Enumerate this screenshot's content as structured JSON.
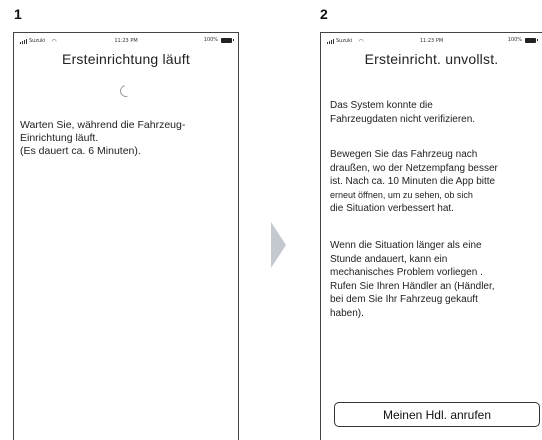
{
  "steps": [
    {
      "number": "1",
      "status_bar": {
        "carrier": "Suzuki",
        "time": "11:23 PM",
        "battery": "100%"
      },
      "title": "Ersteinrichtung läuft",
      "body_lines": [
        "Warten Sie, während die Fahrzeug-",
        "Einrichtung läuft.",
        "(Es dauert ca. 6 Minuten)."
      ]
    },
    {
      "number": "2",
      "status_bar": {
        "carrier": "Suzuki",
        "time": "11:23 PM",
        "battery": "100%"
      },
      "title": "Ersteinricht. unvollst.",
      "paragraph1": [
        "Das System konnte die",
        "Fahrzeugdaten nicht verifizieren."
      ],
      "paragraph2": [
        "Bewegen Sie das Fahrzeug nach",
        "draußen, wo der Netzempfang besser",
        "ist. Nach ca. 10 Minuten die App bitte",
        "erneut öffnen, um zu sehen, ob sich",
        "die Situation verbessert hat."
      ],
      "paragraph3": [
        "Wenn die Situation länger als eine",
        "Stunde andauert, kann ein",
        "mechanisches Problem vorliegen .",
        "Rufen Sie Ihren Händler an (Händler,",
        "bei dem Sie Ihr Fahrzeug gekauft",
        "haben)."
      ],
      "button_label": "Meinen Hdl. anrufen"
    }
  ],
  "icons": {
    "spinner": "loading-spinner",
    "arrow": "arrow-right",
    "signal": "signal-bars",
    "wifi": "wifi",
    "battery": "battery"
  },
  "colors": {
    "arrow": "#c4c8cf",
    "border": "#444444",
    "text": "#222222"
  }
}
